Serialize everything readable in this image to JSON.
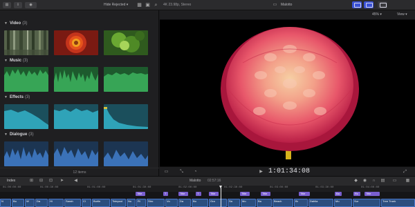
{
  "toolbar": {
    "filter_label": "Hide Rejected",
    "format_label": "4K 23.98p, Stereo",
    "clip_name": "Malotto",
    "zoom_label": "45%",
    "view_label": "View"
  },
  "browser": {
    "sections": [
      {
        "name": "Video",
        "count": "(3)"
      },
      {
        "name": "Music",
        "count": "(3)"
      },
      {
        "name": "Effects",
        "count": "(3)"
      },
      {
        "name": "Dialogue",
        "count": "(3)"
      }
    ],
    "footer": "12 items"
  },
  "viewer": {
    "timecode": "1:01:34:08"
  },
  "timeline": {
    "index_label": "Index",
    "project_name": "Malotto",
    "project_duration": "02:57:16",
    "ruler_labels": [
      "01:00:00:00",
      "01:00:30:00",
      "01:01:00:00",
      "01:01:30:00",
      "01:02:00:00",
      "01:02:30:00",
      "01:03:00:00",
      "01:03:30:00",
      "01:04:00:00"
    ],
    "title_clips": [
      "Title",
      "T",
      "Title",
      "T",
      "Title",
      "Title",
      "Title",
      "Title",
      "Ba",
      "Rc",
      "Title"
    ],
    "video_clips": [
      "N",
      "Bo",
      "W",
      "Da",
      "Hi",
      "Sarah",
      "Cl",
      "Burlin",
      "Tidepool",
      "Nu",
      "Ri",
      "Stro",
      "Vo",
      "Da",
      "Bo",
      "Gra",
      "Sa",
      "Mo",
      "Ba",
      "Beach",
      "Br",
      "Dahlia",
      "Mo",
      "Sur",
      "Tree Trunk"
    ]
  },
  "colors": {
    "accent": "#3b52d6",
    "music_wave": "#2f8f4a",
    "effects_wave": "#2f8fa3",
    "dialogue_wave": "#3a6fb8",
    "title_clip": "#7a5fd0",
    "video_clip": "#2c4e7e"
  }
}
